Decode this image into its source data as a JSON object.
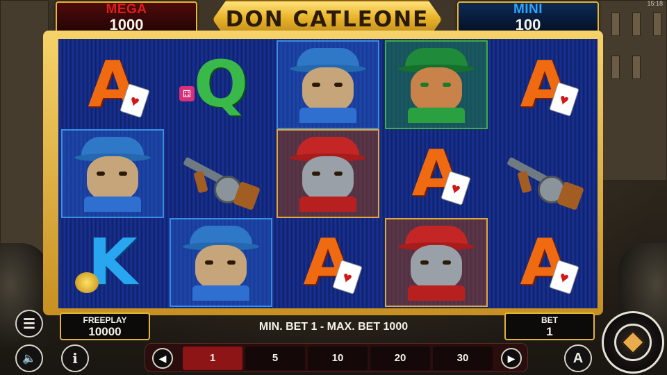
{
  "status": {
    "clock": "15:18"
  },
  "game": {
    "title": "DON CATLEONE"
  },
  "jackpots": {
    "mega": {
      "name": "MEGA",
      "value": "1000"
    },
    "mini": {
      "name": "MINI",
      "value": "100"
    }
  },
  "reels": [
    [
      "A",
      "mafia-cat-blue",
      "K"
    ],
    [
      "Q",
      "tommy-gun",
      "mafia-cat-blue"
    ],
    [
      "mafia-cat-blue",
      "mafia-boss-red",
      "A"
    ],
    [
      "mafia-cat-green",
      "A",
      "mafia-boss-red"
    ],
    [
      "A",
      "tommy-gun",
      "A"
    ]
  ],
  "symbols": {
    "A": "A",
    "Q": "Q",
    "K": "K",
    "card_glyph": "♥",
    "dice_glyph": "⚃"
  },
  "freeplay": {
    "label": "FREEPLAY",
    "value": "10000"
  },
  "bet_range": "MIN. BET 1 - MAX. BET 1000",
  "bet": {
    "label": "BET",
    "value": "1"
  },
  "bet_options": [
    "1",
    "5",
    "10",
    "20",
    "30"
  ],
  "bet_selected": "1",
  "icons": {
    "menu": "☰",
    "sound": "🔈",
    "info": "i",
    "autoplay": "A",
    "prev": "◀",
    "next": "▶"
  }
}
